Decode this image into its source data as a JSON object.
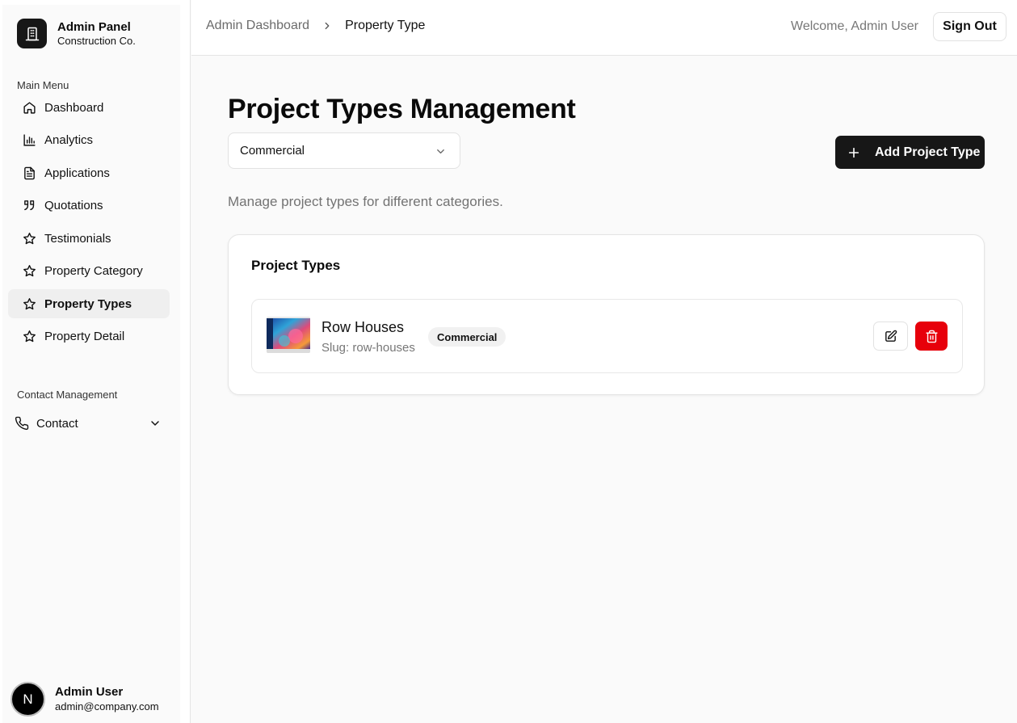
{
  "sidebar": {
    "brand_title": "Admin Panel",
    "brand_subtitle": "Construction Co.",
    "main_menu_label": "Main Menu",
    "items": [
      {
        "label": "Dashboard",
        "icon": "home-icon"
      },
      {
        "label": "Analytics",
        "icon": "bar-chart-icon"
      },
      {
        "label": "Applications",
        "icon": "file-text-icon"
      },
      {
        "label": "Quotations",
        "icon": "quote-icon"
      },
      {
        "label": "Testimonials",
        "icon": "star-icon"
      },
      {
        "label": "Property Category",
        "icon": "star-icon"
      },
      {
        "label": "Property Types",
        "icon": "star-icon",
        "active": true
      },
      {
        "label": "Property Detail",
        "icon": "star-icon"
      }
    ],
    "contact_section_label": "Contact Management",
    "contact_label": "Contact",
    "user": {
      "initial": "N",
      "name": "Admin User",
      "email": "admin@company.com"
    }
  },
  "header": {
    "breadcrumb_parent": "Admin Dashboard",
    "breadcrumb_current": "Property Type",
    "welcome": "Welcome, Admin User",
    "sign_out": "Sign Out"
  },
  "main": {
    "title": "Project Types Management",
    "category_select": "Commercial",
    "add_button": "Add Project Type",
    "description": "Manage project types for different categories.",
    "card_title": "Project Types",
    "rows": [
      {
        "name": "Row Houses",
        "slug": "Slug: row-houses",
        "category": "Commercial"
      }
    ]
  },
  "colors": {
    "primary": "#171717",
    "danger": "#e7000b",
    "background": "#fafafa"
  }
}
